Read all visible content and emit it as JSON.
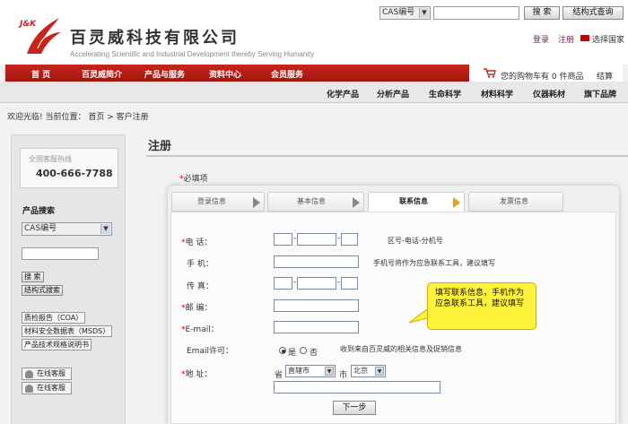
{
  "header": {
    "logo_text": "J&K",
    "company": "百灵威科技有限公司",
    "tagline": "Accelerating Scientific and Industrial Development thereby Serving Humanity",
    "search_select": "CAS编号",
    "search_button": "搜  索",
    "struct_button": "结构式查询",
    "login": "登录",
    "register": "注册",
    "country": "选择国家"
  },
  "nav": {
    "items": [
      "首  页",
      "百灵威简介",
      "产品与服务",
      "资料中心",
      "会员服务"
    ],
    "cart_text": "您的购物车有  0  件商品",
    "checkout": "结算",
    "sub_items": [
      "化学产品",
      "分析产品",
      "生命科学",
      "材料科学",
      "仪器耗材",
      "旗下品牌"
    ]
  },
  "breadcrumb": "欢迎光临! 当前位置：  首页  > 客户注册",
  "sidebar": {
    "hotline_label": "全国客服热线",
    "hotline": "400-666-7788",
    "search_heading": "产品搜索",
    "search_select": "CAS编号",
    "search_button": "搜 索",
    "struct_button": "结构式搜索",
    "links": [
      "质检报告（COA）",
      "材料安全数据表（MSDS）",
      "产品技术规格说明书"
    ],
    "services": [
      "在线客服",
      "在线客服"
    ]
  },
  "main": {
    "title": "注册",
    "required_note": "必填项"
  },
  "steps": [
    "登录信息",
    "基本信息",
    "联系信息",
    "发票信息"
  ],
  "form": {
    "phone_label": "电   话：",
    "phone_hint": "区号-电话-分机号",
    "mobile_label": "手   机：",
    "mobile_hint": "手机号将作为应急联系工具，建议填写",
    "fax_label": "传   真：",
    "zip_label": "邮   编：",
    "email_label": "E-mail：",
    "email_permit_label": "Email许可：",
    "yes": "是",
    "no": "否",
    "permit_hint": "收到来自百灵威的相关信息及促销信息",
    "address_label": "地   址：",
    "province_label": "省",
    "province_value": "直辖市",
    "city_label": "市",
    "city_value": "北京",
    "next_button": "下一步"
  },
  "tooltip": "填写联系信息，手机作为应急联系工具，建议填写",
  "colors": {
    "brand_red": "#b81e16",
    "tooltip_yellow": "#fff23a",
    "active_step_arrow": "#e8a010",
    "required_star": "#dd0000"
  }
}
